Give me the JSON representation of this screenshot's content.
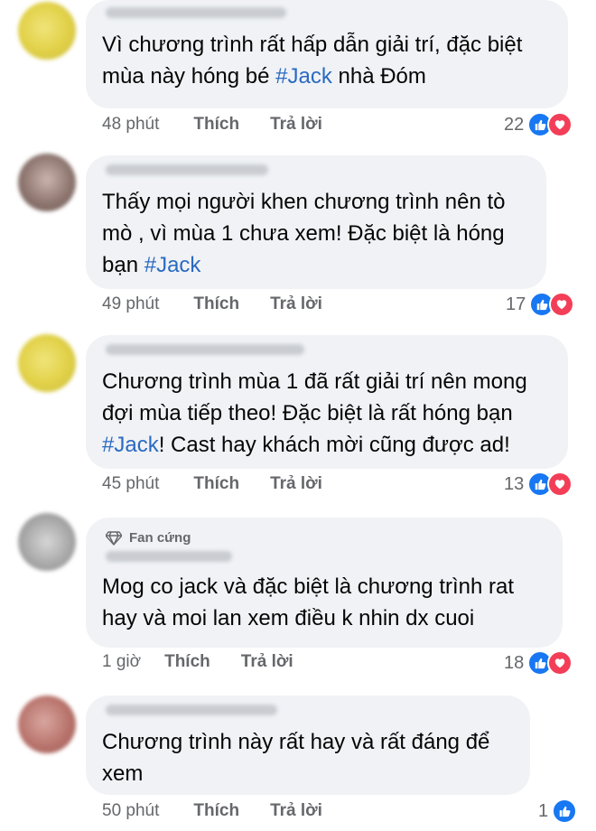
{
  "comments": [
    {
      "text_parts": [
        "Vì chương trình rất hấp dẫn giải trí, đặc biệt mùa này hóng bé ",
        "#Jack",
        " nhà Đóm"
      ],
      "time": "48 phút",
      "like_label": "Thích",
      "reply_label": "Trả lời",
      "reaction_count": "22",
      "reactions": [
        "like-icon",
        "heart-icon"
      ]
    },
    {
      "text_parts": [
        "Thấy mọi người khen chương trình nên tò mò , vì mùa 1 chưa xem! Đặc biệt là hóng bạn ",
        "#Jack",
        ""
      ],
      "time": "49 phút",
      "like_label": "Thích",
      "reply_label": "Trả lời",
      "reaction_count": "17",
      "reactions": [
        "like-icon",
        "heart-icon"
      ]
    },
    {
      "text_parts": [
        "Chương trình mùa 1 đã rất giải trí nên mong đợi mùa tiếp theo! Đặc biệt là rất hóng bạn ",
        "#Jack",
        "! Cast hay khách mời cũng được ad!"
      ],
      "time": "45 phút",
      "like_label": "Thích",
      "reply_label": "Trả lời",
      "reaction_count": "13",
      "reactions": [
        "like-icon",
        "heart-icon"
      ]
    },
    {
      "badge": "Fan cứng",
      "text": "Mog co jack và đặc biệt là chương trình rat hay và moi lan xem điều k nhin dx cuoi",
      "time": "1 giờ",
      "like_label": "Thích",
      "reply_label": "Trả lời",
      "reaction_count": "18",
      "reactions": [
        "like-icon",
        "heart-icon"
      ]
    },
    {
      "text": "Chương trình này rất hay và rất đáng để xem",
      "time": "50 phút",
      "like_label": "Thích",
      "reply_label": "Trả lời",
      "reaction_count": "1",
      "reactions": [
        "like-icon"
      ]
    }
  ],
  "colors": {
    "bubble": "#f0f2f5",
    "hashtag": "#2a6ac2",
    "meta_text": "#65676b",
    "like": "#1877f2",
    "heart": "#f33e58"
  }
}
